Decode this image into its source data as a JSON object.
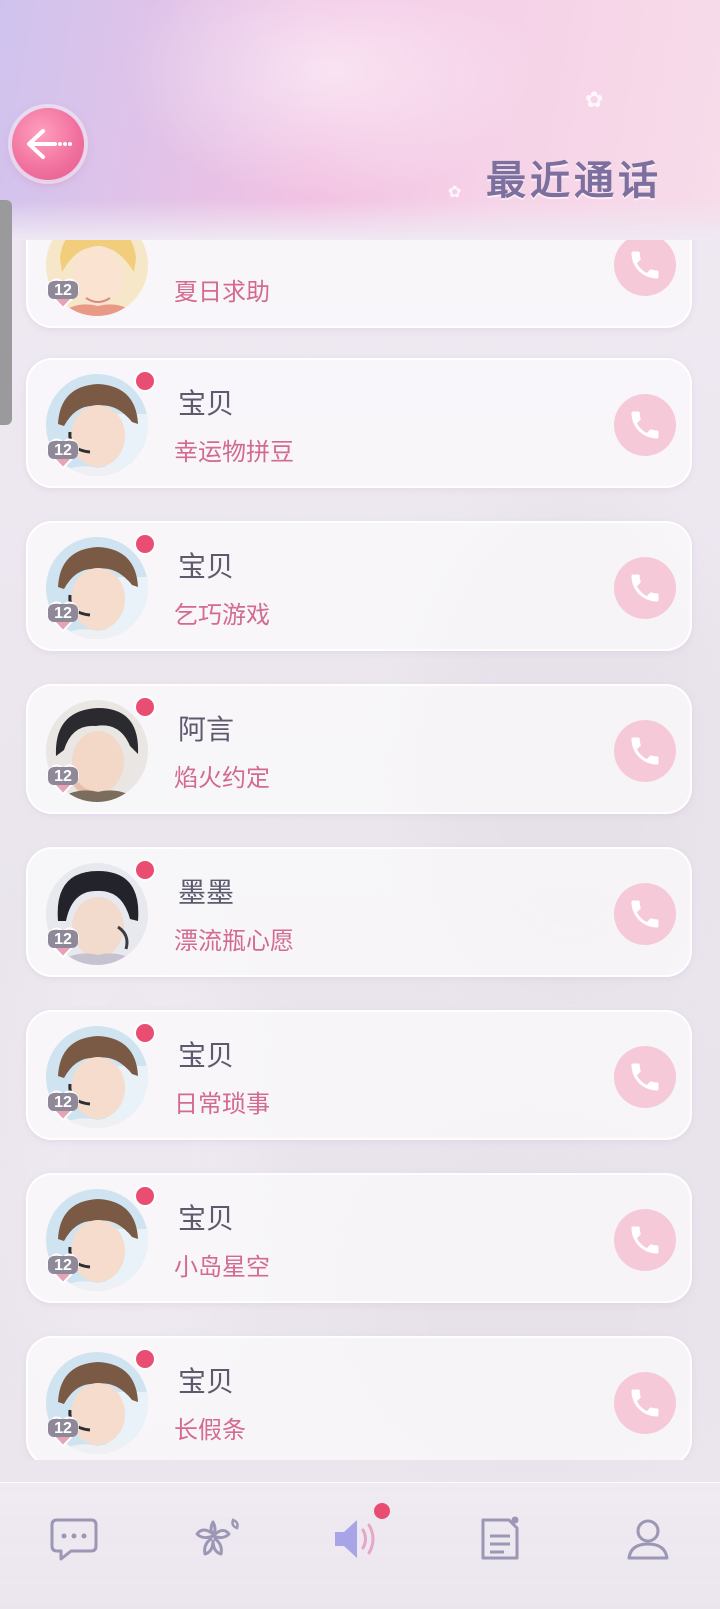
{
  "header": {
    "title": "最近通话",
    "back_icon": "back-arrow-icon"
  },
  "calls": [
    {
      "name": "",
      "topic": "夏日求助",
      "level": "12",
      "unread": false,
      "avatar": "blond"
    },
    {
      "name": "宝贝",
      "topic": "幸运物拼豆",
      "level": "12",
      "unread": true,
      "avatar": "brown"
    },
    {
      "name": "宝贝",
      "topic": "乞巧游戏",
      "level": "12",
      "unread": true,
      "avatar": "brown"
    },
    {
      "name": "阿言",
      "topic": "焰火约定",
      "level": "12",
      "unread": true,
      "avatar": "black-slick"
    },
    {
      "name": "墨墨",
      "topic": "漂流瓶心愿",
      "level": "12",
      "unread": true,
      "avatar": "black"
    },
    {
      "name": "宝贝",
      "topic": "日常琐事",
      "level": "12",
      "unread": true,
      "avatar": "brown"
    },
    {
      "name": "宝贝",
      "topic": "小岛星空",
      "level": "12",
      "unread": true,
      "avatar": "brown"
    },
    {
      "name": "宝贝",
      "topic": "长假条",
      "level": "12",
      "unread": true,
      "avatar": "brown"
    }
  ],
  "nav": [
    {
      "icon": "chat-bubble-icon",
      "active": false,
      "badge": false
    },
    {
      "icon": "sakura-flower-icon",
      "active": false,
      "badge": false
    },
    {
      "icon": "speaker-icon",
      "active": true,
      "badge": true
    },
    {
      "icon": "newspaper-icon",
      "active": false,
      "badge": false
    },
    {
      "icon": "profile-icon",
      "active": false,
      "badge": false
    }
  ],
  "colors": {
    "accent_pink": "#d36a8f",
    "unread_dot": "#ea4d72",
    "call_button": "#f6c9d8",
    "title_purple": "#7d6f9e",
    "nav_active": "#a9a3e8"
  }
}
